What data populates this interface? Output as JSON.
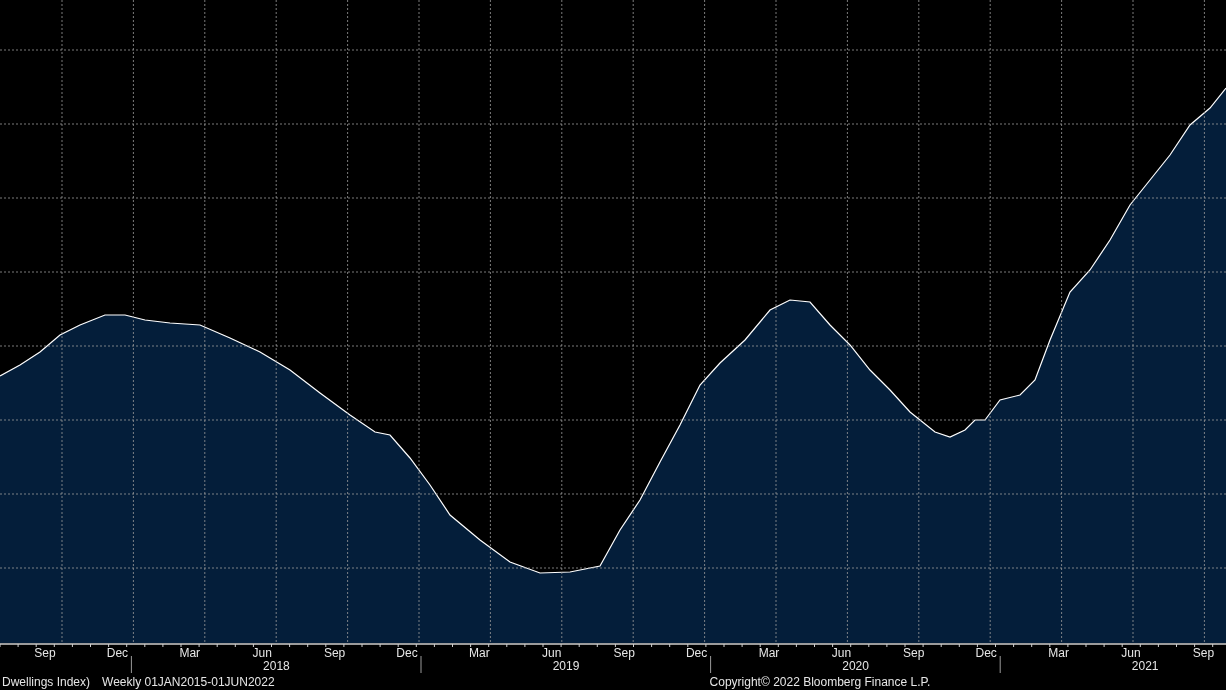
{
  "x_axis": {
    "months": [
      "Sep",
      "Dec",
      "Mar",
      "Jun",
      "Sep",
      "Dec",
      "Mar",
      "Jun",
      "Sep",
      "Dec",
      "Mar",
      "Jun",
      "Sep",
      "Dec",
      "Mar",
      "Jun",
      "Sep"
    ],
    "years": [
      "2018",
      "2019",
      "2020",
      "2021"
    ]
  },
  "footer": {
    "series_name": "Dwellings Index)",
    "series_range": "Weekly 01JAN2015-01JUN2022",
    "copyright": "Copyright© 2022 Bloomberg Finance L.P."
  }
}
